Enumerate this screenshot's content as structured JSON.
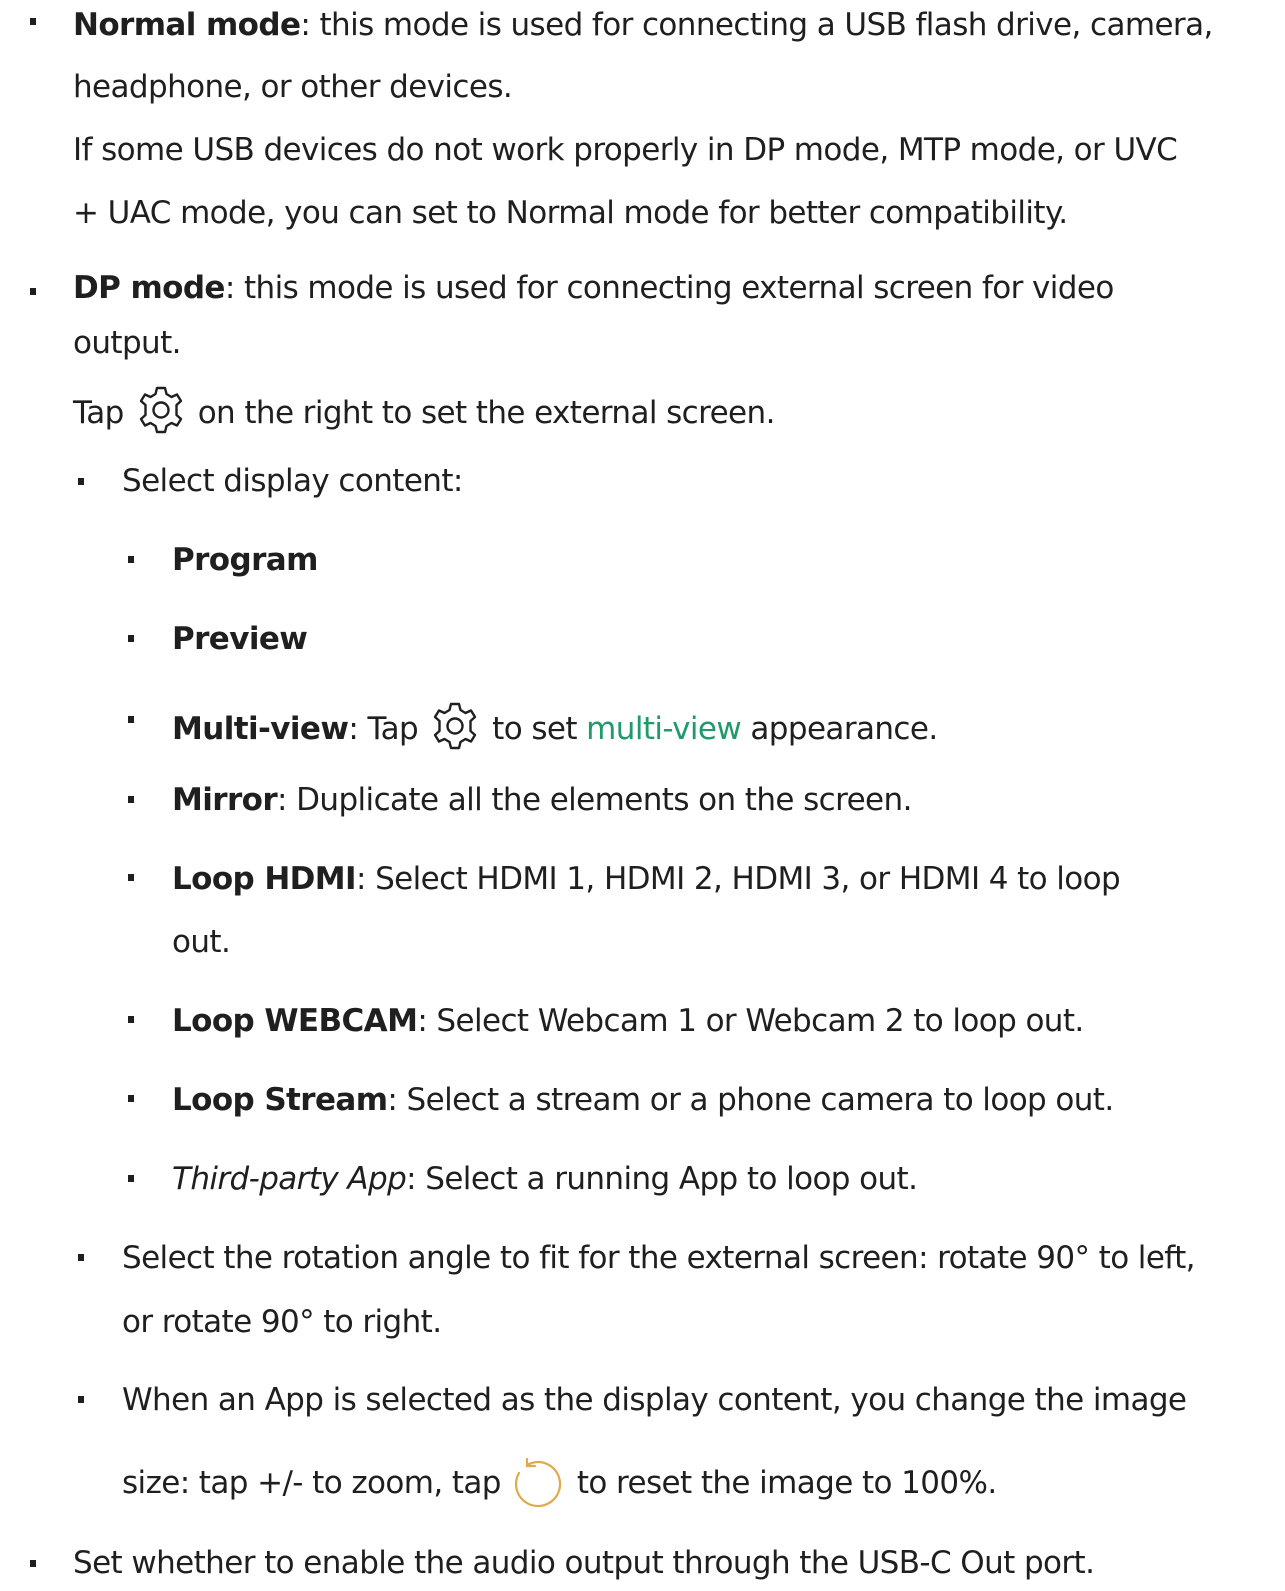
{
  "normal_mode": {
    "term": "Normal mode",
    "desc_line1": ": this mode is used for connecting a USB flash drive, camera,",
    "desc_line2": "headphone, or other devices.",
    "note_line1": "If some USB devices do not work properly in DP mode, MTP mode, or UVC",
    "note_line2": "+ UAC mode, you can set to Normal mode for better compatibility."
  },
  "dp_mode": {
    "term": "DP mode",
    "desc_line1": ": this mode is used for connecting external screen for video",
    "desc_line2": "output.",
    "tap_prefix": "Tap",
    "tap_suffix": "on the right to set the external screen.",
    "select_content": "Select display content:",
    "content_options": [
      {
        "term": "Program"
      },
      {
        "term": "Preview"
      },
      {
        "term": "Multi-view",
        "pre": ": Tap",
        "mid": "to set",
        "link": "multi-view",
        "post": "appearance."
      },
      {
        "term": "Mirror",
        "desc": ": Duplicate all the elements on the screen."
      },
      {
        "term": "Loop HDMI",
        "desc": ": Select HDMI 1, HDMI 2, HDMI 3, or HDMI 4 to loop",
        "desc2": "out."
      },
      {
        "term": "Loop WEBCAM",
        "desc": ": Select Webcam 1 or Webcam 2 to loop out."
      },
      {
        "term": "Loop Stream",
        "desc": ": Select a stream or a phone camera to loop out."
      },
      {
        "term": "Third-party App",
        "desc": ": Select a running App to loop out."
      }
    ],
    "rotation_line1": "Select the rotation angle to fit for the external screen: rotate 90° to left,",
    "rotation_line2": "or rotate 90° to right.",
    "app_size_line1": "When an App is selected as the display content, you change the image",
    "app_size_prefix": "size: tap +/- to zoom, tap",
    "app_size_suffix": "to reset the image to 100%."
  },
  "audio_output": "Set whether to enable the audio output through the USB-C Out port.",
  "icons": {
    "gear": "gear-icon",
    "reset": "reset-icon"
  },
  "colors": {
    "text": "#1f1f1f",
    "link": "#1f9a6a",
    "reset_icon": "#e0a94a"
  }
}
